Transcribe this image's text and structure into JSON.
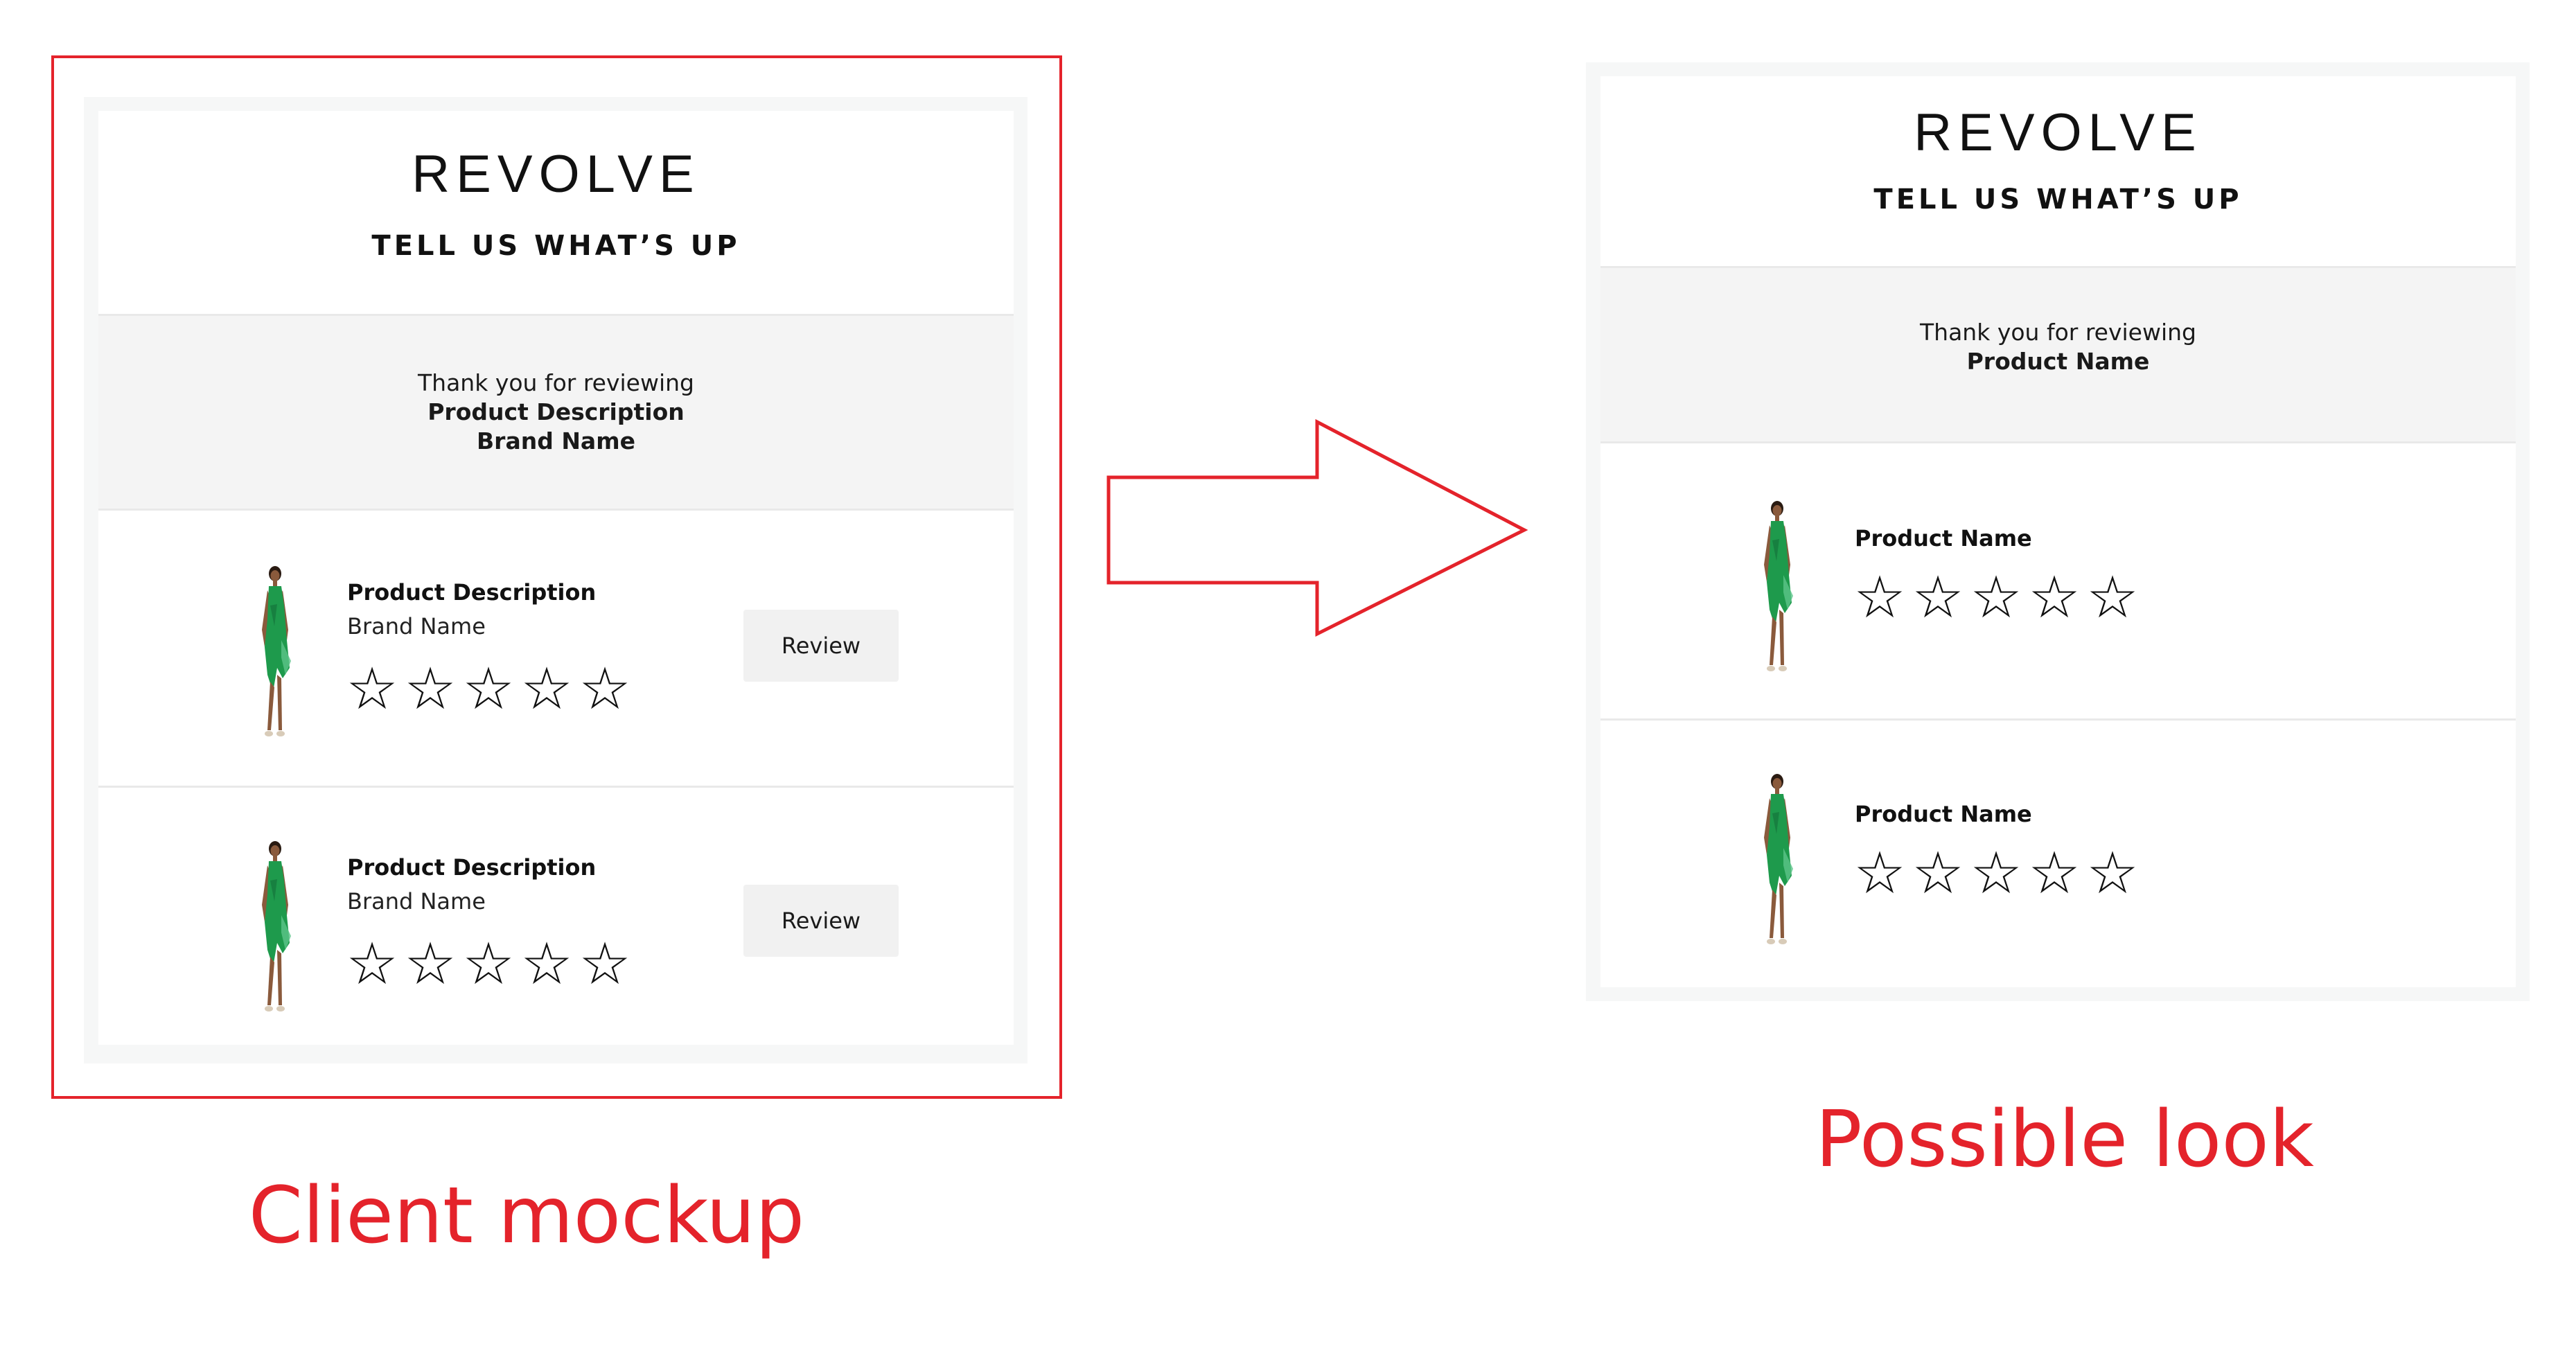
{
  "colors": {
    "accent_red": "#e4232b",
    "panel_bg": "#f6f7f7",
    "band_bg": "#f4f4f4",
    "button_bg": "#f1f1f1",
    "dress_green": "#1e9a4c"
  },
  "mockup": {
    "caption": "Client mockup",
    "logo": "REVOLVE",
    "tagline": "TELL US WHAT’S UP",
    "thanks_intro": "Thank you for reviewing",
    "thanks_product": "Product Description",
    "thanks_brand": "Brand Name",
    "products": [
      {
        "title": "Product Description",
        "brand": "Brand Name",
        "review_label": "Review",
        "rating": 0,
        "max_rating": 5
      },
      {
        "title": "Product Description",
        "brand": "Brand Name",
        "review_label": "Review",
        "rating": 0,
        "max_rating": 5
      }
    ]
  },
  "look": {
    "caption": "Possible look",
    "logo": "REVOLVE",
    "tagline": "TELL US WHAT’S UP",
    "thanks_intro": "Thank you for reviewing",
    "thanks_product": "Product Name",
    "products": [
      {
        "title": "Product Name",
        "rating": 0,
        "max_rating": 5
      },
      {
        "title": "Product Name",
        "rating": 0,
        "max_rating": 5
      }
    ]
  },
  "icons": {
    "star": "star-outline-icon",
    "arrow": "right-arrow-icon",
    "product_image": "dress-model-image"
  }
}
